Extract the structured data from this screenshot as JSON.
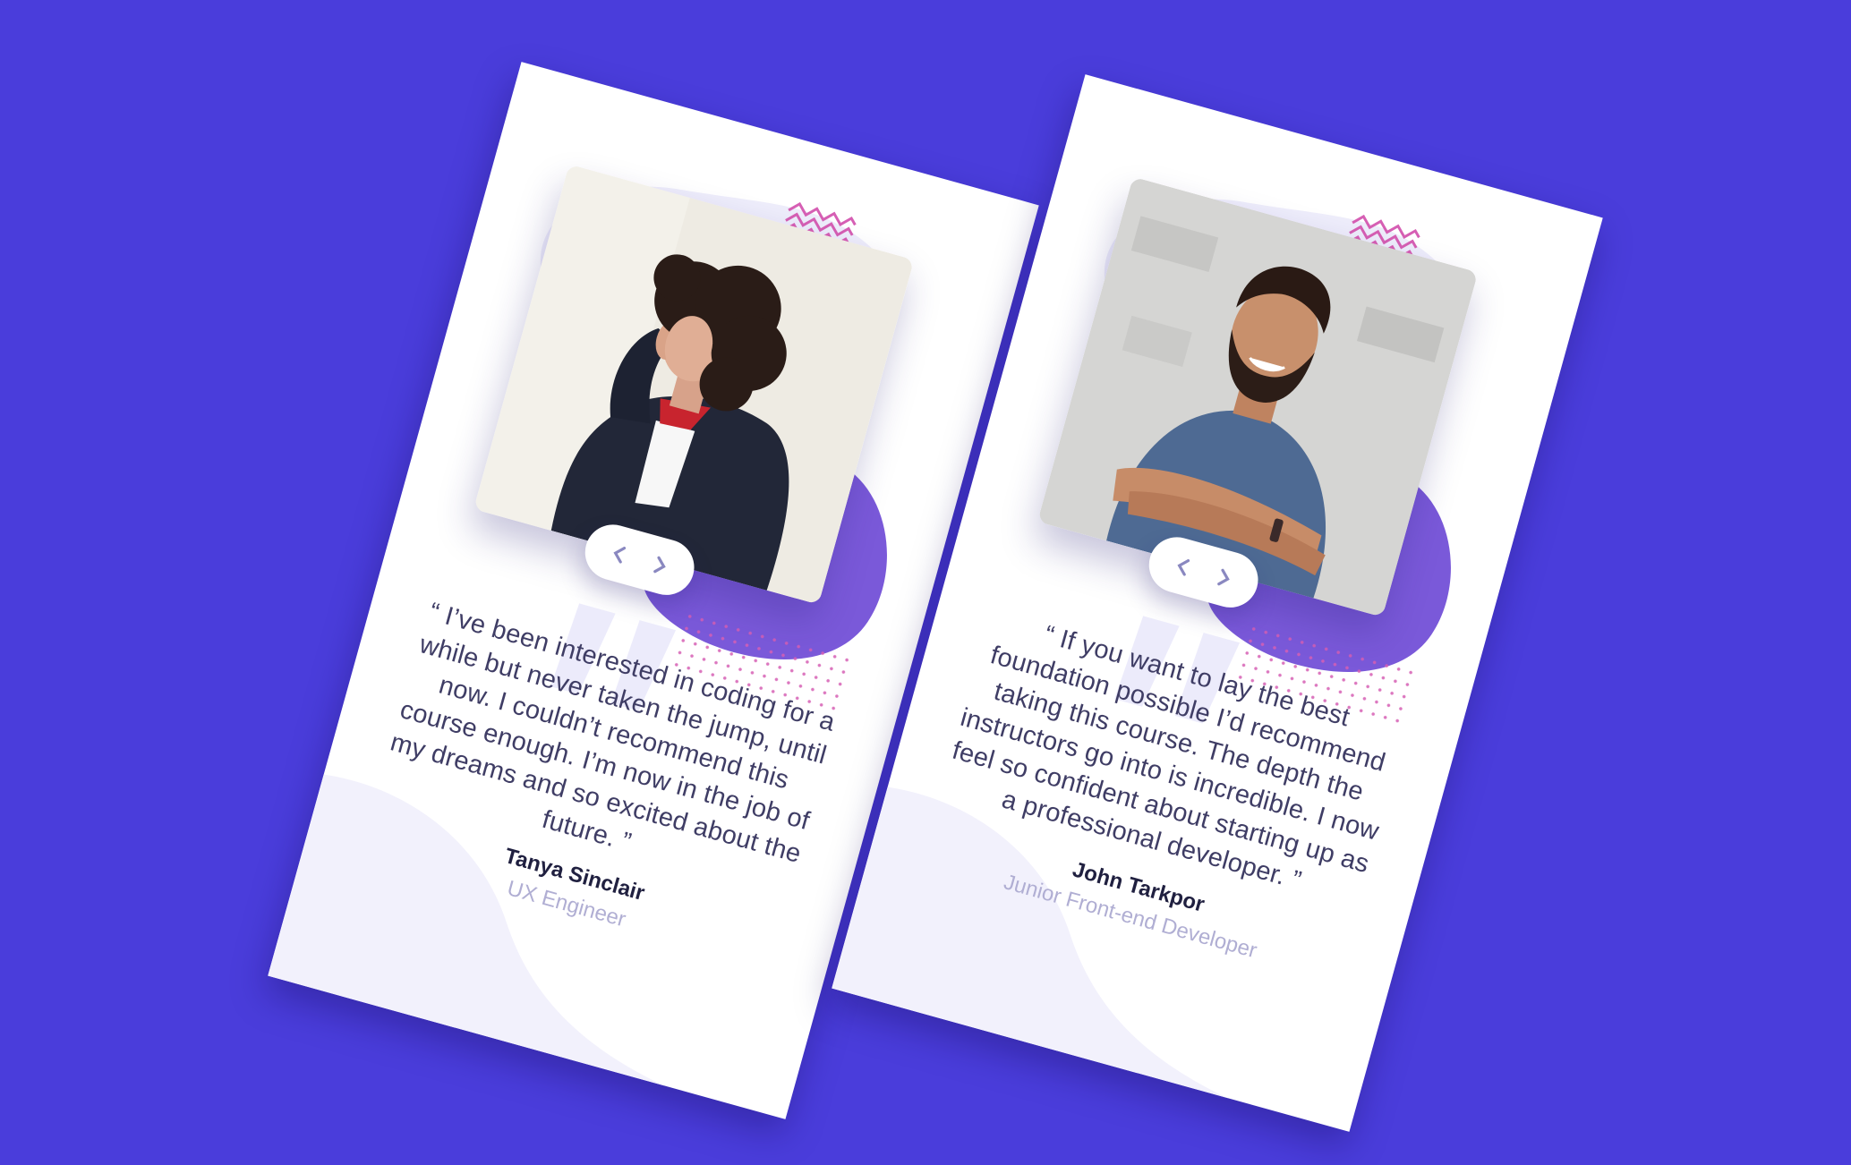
{
  "colors": {
    "background": "#4a3ddb",
    "card": "#ffffff",
    "accent_purple": "#7a59d9",
    "accent_pink": "#d65fb4",
    "soft_lavender": "#eeedfb",
    "quote_text": "#3f3d65",
    "name_text": "#202040",
    "role_text": "#b0aed3"
  },
  "testimonials": [
    {
      "quote": "“ I’ve been interested in coding for a while but never taken the jump, until now. I couldn’t recommend this course enough. I’m now in the job of my dreams and so excited about the future. ”",
      "name": "Tanya Sinclair",
      "role": "UX Engineer",
      "photo_icon": "portrait-woman-curly-hair",
      "prev_icon": "chevron-left-icon",
      "next_icon": "chevron-right-icon"
    },
    {
      "quote": "“ If you want to lay the best foundation possible I’d recommend taking this course. The depth the instructors go into is incredible. I now feel so confident about starting up as a professional developer. ”",
      "name": "John Tarkpor",
      "role": "Junior Front-end Developer",
      "photo_icon": "portrait-man-arms-crossed",
      "prev_icon": "chevron-left-icon",
      "next_icon": "chevron-right-icon"
    }
  ]
}
